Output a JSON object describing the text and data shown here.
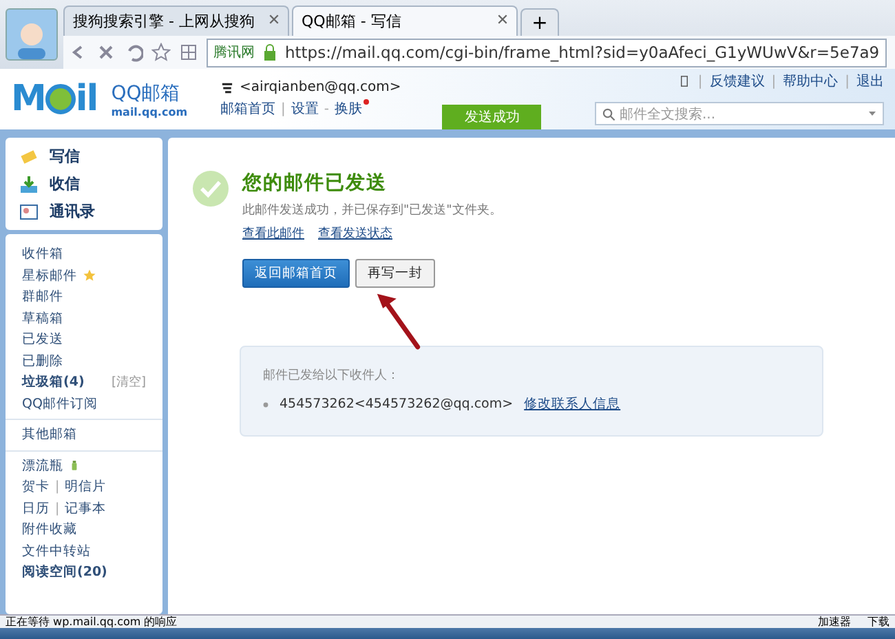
{
  "browser": {
    "tabs": [
      {
        "label": "搜狗搜索引擎 - 上网从搜狗",
        "selected": false
      },
      {
        "label": "QQ邮箱 - 写信",
        "selected": true
      }
    ],
    "new_tab": "+",
    "site_label": "腾讯网",
    "url": "https://mail.qq.com/cgi-bin/frame_html?sid=y0aAfeci_G1yWUwV&r=5e7a9"
  },
  "header": {
    "logo_left": "M",
    "logo_right": "il",
    "brand": "QQ邮箱",
    "brand_sub": "mail.qq.com",
    "account": "<airqianben@qq.com>",
    "nav": [
      {
        "label": "邮箱首页",
        "new": false
      },
      {
        "separator": "|",
        "label": "设置",
        "new": false
      },
      {
        "separator": "-",
        "label": "换肤",
        "new": true
      }
    ],
    "top_links": [
      {
        "separator": "|",
        "label": "反馈建议"
      },
      {
        "separator": "|",
        "label": "帮助中心"
      },
      {
        "separator": "|",
        "label": "退出"
      }
    ],
    "notice": "发送成功",
    "search": {
      "placeholder": "邮件全文搜索..."
    }
  },
  "sidebar": {
    "actions": [
      {
        "kind": "write",
        "label": "写信"
      },
      {
        "kind": "receive",
        "label": "收信"
      },
      {
        "kind": "contacts",
        "label": "通讯录"
      }
    ],
    "groups": [
      [
        {
          "label": "收件箱",
          "bold": false
        },
        {
          "label": "星标邮件",
          "bold": false,
          "kind": "starred"
        },
        {
          "label": "群邮件",
          "bold": false
        },
        {
          "label": "草稿箱",
          "bold": false
        },
        {
          "label": "已发送",
          "bold": false
        },
        {
          "label": "已删除",
          "bold": false
        },
        {
          "label": "垃圾箱(4)",
          "bold": true,
          "action": "[清空]"
        },
        {
          "label": "QQ邮件订阅",
          "bold": false
        }
      ],
      [
        {
          "label": "其他邮箱",
          "bold": false
        }
      ],
      [
        {
          "label": "漂流瓶",
          "bold": false,
          "kind": "bottle"
        },
        {
          "label": "贺卡",
          "bold": false,
          "separator": "|",
          "second": "明信片"
        },
        {
          "label": "日历",
          "bold": false,
          "separator": "|",
          "second": "记事本"
        },
        {
          "label": "附件收藏",
          "bold": false
        },
        {
          "label": "文件中转站",
          "bold": false
        },
        {
          "label": "阅读空间(20)",
          "bold": true
        }
      ]
    ]
  },
  "result": {
    "title": "您的邮件已发送",
    "message": "此邮件发送成功，并已保存到\"已发送\"文件夹。",
    "links": [
      "查看此邮件",
      "查看发送状态"
    ],
    "buttons": [
      {
        "label": "返回邮箱首页",
        "primary": true
      },
      {
        "label": "再写一封",
        "primary": false
      }
    ],
    "recipients_title": "邮件已发给以下收件人：",
    "recipients": [
      {
        "address": "454573262<454573262@qq.com>",
        "action": "修改联系人信息"
      }
    ]
  },
  "status_bar": {
    "text": "正在等待 wp.mail.qq.com 的响应",
    "right": [
      "加速器",
      "下载"
    ]
  }
}
